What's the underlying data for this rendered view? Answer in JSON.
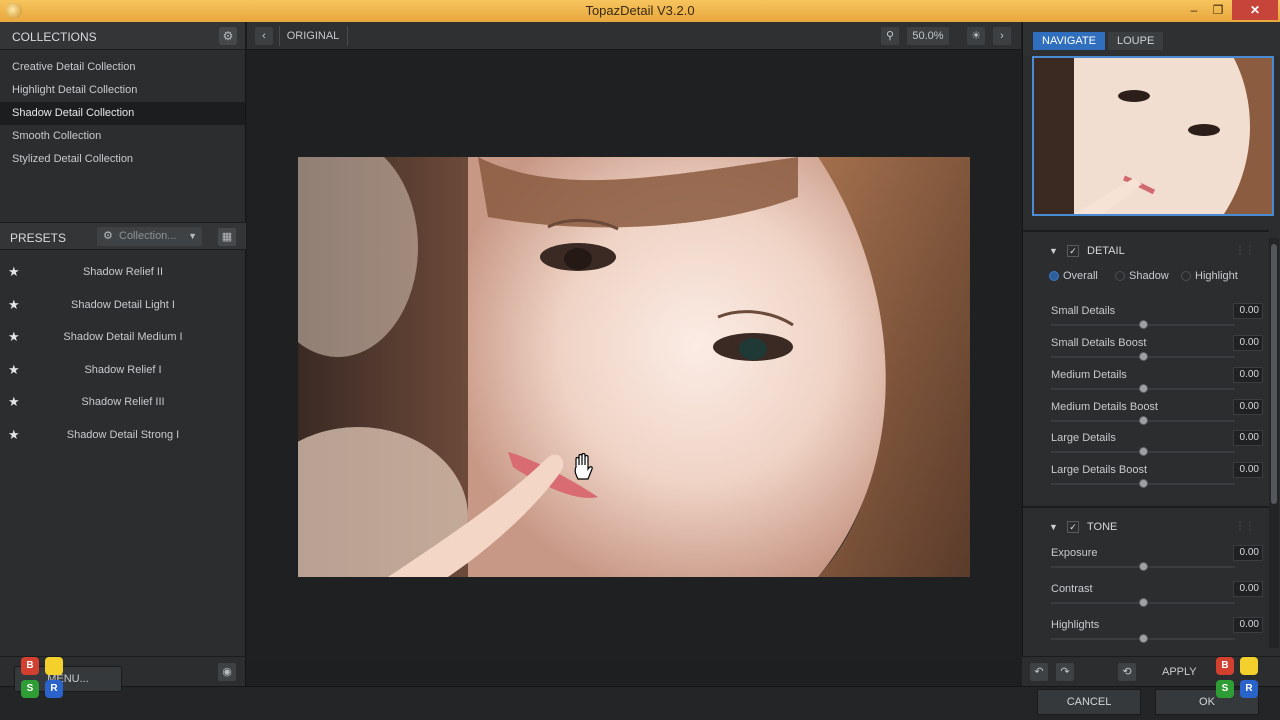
{
  "window": {
    "title": "TopazDetail V3.2.0",
    "min": "‒",
    "max": "❐",
    "close": "✕"
  },
  "collections": {
    "header": "COLLECTIONS",
    "items": [
      {
        "label": "Creative Detail Collection",
        "selected": false
      },
      {
        "label": "Highlight Detail Collection",
        "selected": false
      },
      {
        "label": "Shadow Detail Collection",
        "selected": true
      },
      {
        "label": "Smooth Collection",
        "selected": false
      },
      {
        "label": "Stylized Detail Collection",
        "selected": false
      }
    ]
  },
  "presets": {
    "header": "PRESETS",
    "dropdown_value": "Collection...",
    "items": [
      "Shadow Relief II",
      "Shadow Detail Light I",
      "Shadow Detail Medium I",
      "Shadow Relief I",
      "Shadow Relief III",
      "Shadow Detail Strong I"
    ]
  },
  "left_bottom": {
    "menu_label": "MENU..."
  },
  "toolbar": {
    "view_label": "ORIGINAL",
    "zoom": "50.0%"
  },
  "navigator": {
    "tabs": [
      "NAVIGATE",
      "LOUPE"
    ],
    "active_tab": "NAVIGATE"
  },
  "detail": {
    "header": "DETAIL",
    "modes": [
      "Overall",
      "Shadow",
      "Highlight"
    ],
    "active_mode": "Overall",
    "sliders": [
      {
        "label": "Small Details",
        "value": "0.00"
      },
      {
        "label": "Small Details Boost",
        "value": "0.00"
      },
      {
        "label": "Medium Details",
        "value": "0.00"
      },
      {
        "label": "Medium Details Boost",
        "value": "0.00"
      },
      {
        "label": "Large Details",
        "value": "0.00"
      },
      {
        "label": "Large Details Boost",
        "value": "0.00"
      }
    ]
  },
  "tone": {
    "header": "TONE",
    "sliders": [
      {
        "label": "Exposure",
        "value": "0.00"
      },
      {
        "label": "Contrast",
        "value": "0.00"
      },
      {
        "label": "Highlights",
        "value": "0.00"
      }
    ]
  },
  "actions": {
    "apply": "APPLY",
    "cancel": "CANCEL",
    "ok": "OK"
  },
  "hotkeys": {
    "red": "B",
    "yellow": "",
    "green": "S",
    "blue": "R"
  },
  "colors": {
    "accent": "#2f6fbd",
    "titlebar": "#f0b54a",
    "close": "#c7443a"
  }
}
